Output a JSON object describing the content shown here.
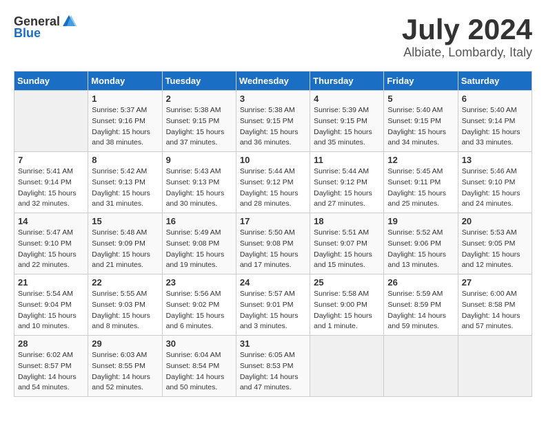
{
  "header": {
    "logo_general": "General",
    "logo_blue": "Blue",
    "month": "July 2024",
    "location": "Albiate, Lombardy, Italy"
  },
  "weekdays": [
    "Sunday",
    "Monday",
    "Tuesday",
    "Wednesday",
    "Thursday",
    "Friday",
    "Saturday"
  ],
  "weeks": [
    [
      {
        "day": "",
        "info": ""
      },
      {
        "day": "1",
        "info": "Sunrise: 5:37 AM\nSunset: 9:16 PM\nDaylight: 15 hours\nand 38 minutes."
      },
      {
        "day": "2",
        "info": "Sunrise: 5:38 AM\nSunset: 9:15 PM\nDaylight: 15 hours\nand 37 minutes."
      },
      {
        "day": "3",
        "info": "Sunrise: 5:38 AM\nSunset: 9:15 PM\nDaylight: 15 hours\nand 36 minutes."
      },
      {
        "day": "4",
        "info": "Sunrise: 5:39 AM\nSunset: 9:15 PM\nDaylight: 15 hours\nand 35 minutes."
      },
      {
        "day": "5",
        "info": "Sunrise: 5:40 AM\nSunset: 9:15 PM\nDaylight: 15 hours\nand 34 minutes."
      },
      {
        "day": "6",
        "info": "Sunrise: 5:40 AM\nSunset: 9:14 PM\nDaylight: 15 hours\nand 33 minutes."
      }
    ],
    [
      {
        "day": "7",
        "info": "Sunrise: 5:41 AM\nSunset: 9:14 PM\nDaylight: 15 hours\nand 32 minutes."
      },
      {
        "day": "8",
        "info": "Sunrise: 5:42 AM\nSunset: 9:13 PM\nDaylight: 15 hours\nand 31 minutes."
      },
      {
        "day": "9",
        "info": "Sunrise: 5:43 AM\nSunset: 9:13 PM\nDaylight: 15 hours\nand 30 minutes."
      },
      {
        "day": "10",
        "info": "Sunrise: 5:44 AM\nSunset: 9:12 PM\nDaylight: 15 hours\nand 28 minutes."
      },
      {
        "day": "11",
        "info": "Sunrise: 5:44 AM\nSunset: 9:12 PM\nDaylight: 15 hours\nand 27 minutes."
      },
      {
        "day": "12",
        "info": "Sunrise: 5:45 AM\nSunset: 9:11 PM\nDaylight: 15 hours\nand 25 minutes."
      },
      {
        "day": "13",
        "info": "Sunrise: 5:46 AM\nSunset: 9:10 PM\nDaylight: 15 hours\nand 24 minutes."
      }
    ],
    [
      {
        "day": "14",
        "info": "Sunrise: 5:47 AM\nSunset: 9:10 PM\nDaylight: 15 hours\nand 22 minutes."
      },
      {
        "day": "15",
        "info": "Sunrise: 5:48 AM\nSunset: 9:09 PM\nDaylight: 15 hours\nand 21 minutes."
      },
      {
        "day": "16",
        "info": "Sunrise: 5:49 AM\nSunset: 9:08 PM\nDaylight: 15 hours\nand 19 minutes."
      },
      {
        "day": "17",
        "info": "Sunrise: 5:50 AM\nSunset: 9:08 PM\nDaylight: 15 hours\nand 17 minutes."
      },
      {
        "day": "18",
        "info": "Sunrise: 5:51 AM\nSunset: 9:07 PM\nDaylight: 15 hours\nand 15 minutes."
      },
      {
        "day": "19",
        "info": "Sunrise: 5:52 AM\nSunset: 9:06 PM\nDaylight: 15 hours\nand 13 minutes."
      },
      {
        "day": "20",
        "info": "Sunrise: 5:53 AM\nSunset: 9:05 PM\nDaylight: 15 hours\nand 12 minutes."
      }
    ],
    [
      {
        "day": "21",
        "info": "Sunrise: 5:54 AM\nSunset: 9:04 PM\nDaylight: 15 hours\nand 10 minutes."
      },
      {
        "day": "22",
        "info": "Sunrise: 5:55 AM\nSunset: 9:03 PM\nDaylight: 15 hours\nand 8 minutes."
      },
      {
        "day": "23",
        "info": "Sunrise: 5:56 AM\nSunset: 9:02 PM\nDaylight: 15 hours\nand 6 minutes."
      },
      {
        "day": "24",
        "info": "Sunrise: 5:57 AM\nSunset: 9:01 PM\nDaylight: 15 hours\nand 3 minutes."
      },
      {
        "day": "25",
        "info": "Sunrise: 5:58 AM\nSunset: 9:00 PM\nDaylight: 15 hours\nand 1 minute."
      },
      {
        "day": "26",
        "info": "Sunrise: 5:59 AM\nSunset: 8:59 PM\nDaylight: 14 hours\nand 59 minutes."
      },
      {
        "day": "27",
        "info": "Sunrise: 6:00 AM\nSunset: 8:58 PM\nDaylight: 14 hours\nand 57 minutes."
      }
    ],
    [
      {
        "day": "28",
        "info": "Sunrise: 6:02 AM\nSunset: 8:57 PM\nDaylight: 14 hours\nand 54 minutes."
      },
      {
        "day": "29",
        "info": "Sunrise: 6:03 AM\nSunset: 8:55 PM\nDaylight: 14 hours\nand 52 minutes."
      },
      {
        "day": "30",
        "info": "Sunrise: 6:04 AM\nSunset: 8:54 PM\nDaylight: 14 hours\nand 50 minutes."
      },
      {
        "day": "31",
        "info": "Sunrise: 6:05 AM\nSunset: 8:53 PM\nDaylight: 14 hours\nand 47 minutes."
      },
      {
        "day": "",
        "info": ""
      },
      {
        "day": "",
        "info": ""
      },
      {
        "day": "",
        "info": ""
      }
    ]
  ]
}
